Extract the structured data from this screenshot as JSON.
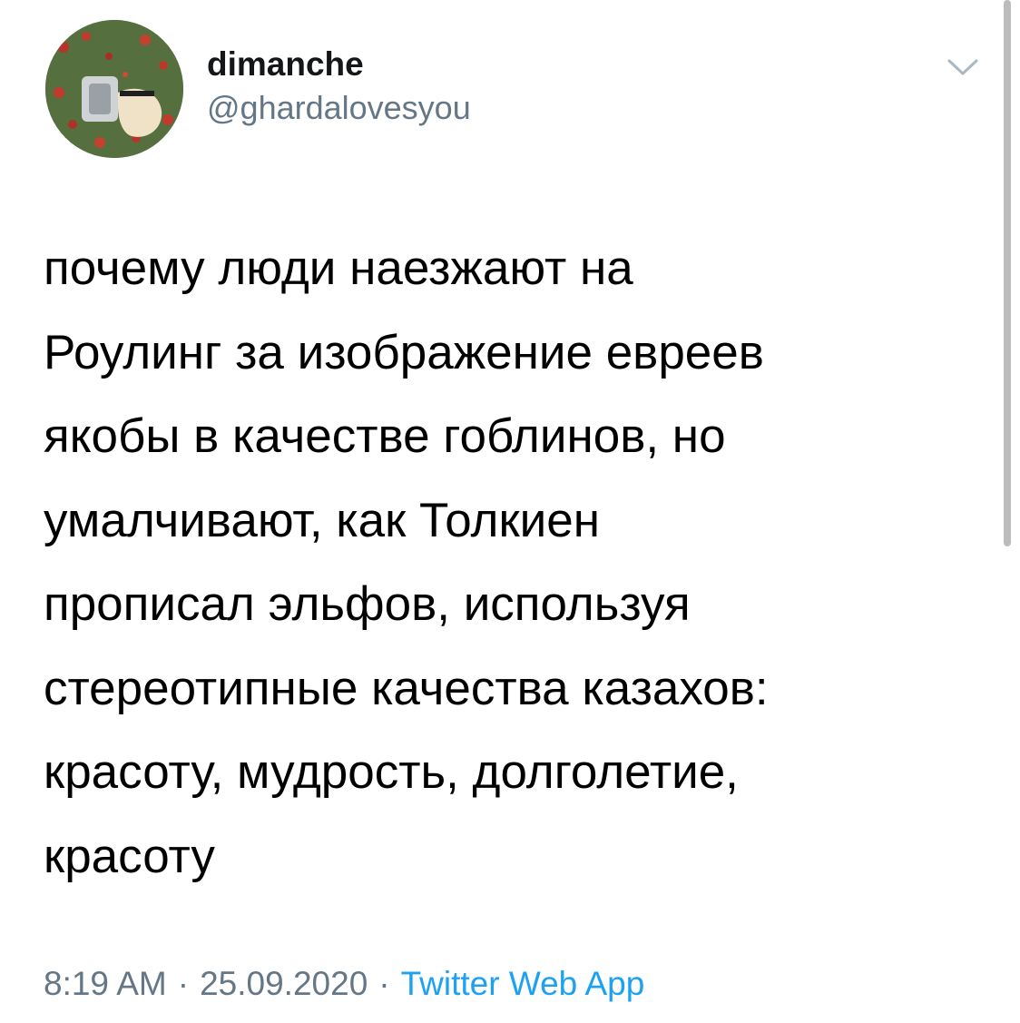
{
  "author": {
    "display_name": "dimanche",
    "handle": "@ghardalovesyou"
  },
  "icons": {
    "avatar": "avatar-image",
    "menu": "chevron-down-icon"
  },
  "tweet": {
    "lines": [
      "почему люди наезжают на",
      "Роулинг за изображение евреев",
      "якобы в качестве гоблинов, но",
      "умалчивают, как Толкиен",
      "прописал эльфов, используя",
      "стереотипные качества казахов:",
      "красоту, мудрость, долголетие,",
      "красоту"
    ]
  },
  "meta": {
    "time": "8:19 AM",
    "separator": "·",
    "date": "25.09.2020",
    "source": "Twitter Web App"
  },
  "colors": {
    "text": "#000000",
    "secondary": "#657786",
    "link": "#1da1f2",
    "chevron": "#aab8c2"
  }
}
